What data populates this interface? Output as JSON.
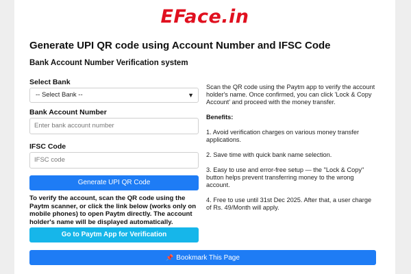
{
  "brand": {
    "logo": "EFace.in"
  },
  "page": {
    "title": "Generate UPI QR code using Account Number and IFSC Code",
    "subtitle": "Bank Account Number Verification system"
  },
  "form": {
    "bank_label": "Select Bank",
    "bank_selected": "-- Select Bank --",
    "account_label": "Bank Account Number",
    "account_placeholder": "Enter bank account number",
    "ifsc_label": "IFSC Code",
    "ifsc_placeholder": "IFSC code",
    "generate_button": "Generate UPI QR Code"
  },
  "note": "To verify the account, scan the QR code using the Paytm scanner, or click the link below (works only on mobile phones) to open Paytm directly. The account holder's name will be displayed automatically.",
  "paytm_button": "Go to Paytm App for Verification",
  "info": {
    "intro": "Scan the QR code using the Paytm app to verify the account holder's name. Once confirmed, you can click 'Lock & Copy Account' and proceed with the money transfer.",
    "benefits_title": "Benefits:",
    "benefits": [
      "1. Avoid verification charges on various money transfer applications.",
      "2. Save time with quick bank name selection.",
      "3. Easy to use and error-free setup — the \"Lock & Copy\" button helps prevent transferring money to the wrong account.",
      "4. Free to use until 31st Dec 2025. After that, a user charge of Rs. 49/Month will apply."
    ]
  },
  "bookmark_button": "Bookmark This Page",
  "icons": {
    "pin": "pushpin-icon",
    "chevron": "chevron-down-icon"
  },
  "colors": {
    "brand": "#e0101f",
    "primary": "#1e7cf5",
    "paytm": "#16b6ea"
  }
}
